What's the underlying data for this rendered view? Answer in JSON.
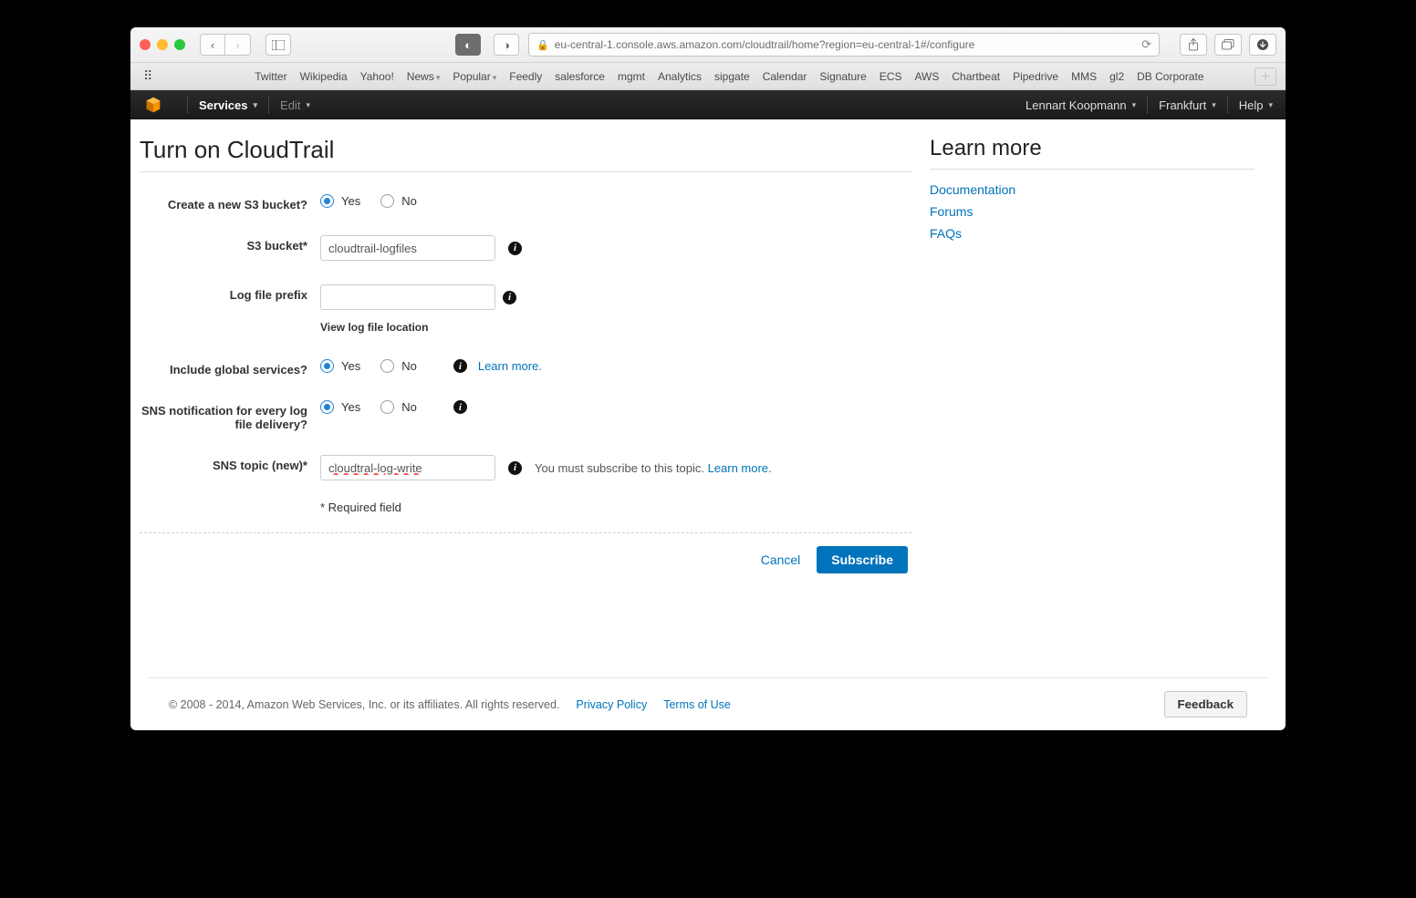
{
  "browser": {
    "url": "eu-central-1.console.aws.amazon.com/cloudtrail/home?region=eu-central-1#/configure",
    "bookmarks": [
      "Twitter",
      "Wikipedia",
      "Yahoo!",
      "News",
      "Popular",
      "Feedly",
      "salesforce",
      "mgmt",
      "Analytics",
      "sipgate",
      "Calendar",
      "Signature",
      "ECS",
      "AWS",
      "Chartbeat",
      "Pipedrive",
      "MMS",
      "gl2",
      "DB Corporate"
    ]
  },
  "awsbar": {
    "services": "Services",
    "edit": "Edit",
    "user": "Lennart Koopmann",
    "region": "Frankfurt",
    "help": "Help"
  },
  "page": {
    "title": "Turn on CloudTrail",
    "labels": {
      "create_bucket": "Create a new S3 bucket?",
      "s3_bucket": "S3 bucket*",
      "log_prefix": "Log file prefix",
      "global_services": "Include global services?",
      "sns_delivery": "SNS notification for every log file delivery?",
      "sns_topic": "SNS topic (new)*"
    },
    "radio": {
      "yes": "Yes",
      "no": "No"
    },
    "values": {
      "s3_bucket": "cloudtrail-logfiles",
      "log_prefix": "",
      "sns_topic": "cloudtral-log-write"
    },
    "view_log_location": "View log file location",
    "learn_more": "Learn more.",
    "sns_subscribe_note": "You must subscribe to this topic. ",
    "required_note": "* Required field",
    "actions": {
      "cancel": "Cancel",
      "subscribe": "Subscribe"
    }
  },
  "sidebar": {
    "title": "Learn more",
    "links": [
      "Documentation",
      "Forums",
      "FAQs"
    ]
  },
  "footer": {
    "copyright": "© 2008 - 2014, Amazon Web Services, Inc. or its affiliates. All rights reserved.",
    "privacy": "Privacy Policy",
    "terms": "Terms of Use",
    "feedback": "Feedback"
  }
}
